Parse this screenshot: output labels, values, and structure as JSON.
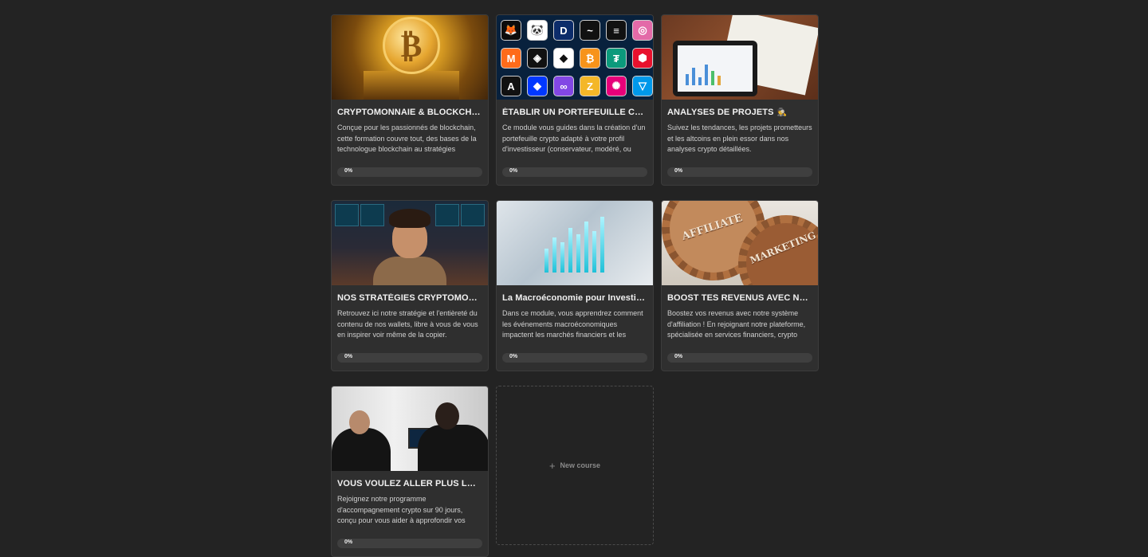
{
  "courses": [
    {
      "title": "CRYPTOMONNAIE & BLOCKCHAIN",
      "description": "Conçue pour les passionnés de blockchain, cette formation couvre tout, des bases de la technologue blockchain au stratégies",
      "progress": "0%",
      "progress_value": 0,
      "thumbnail": "bitcoin-gold-coin-image"
    },
    {
      "title": "ÉTABLIR UN PORTEFEUILLE CRY...",
      "description": "Ce module vous guides dans la création d'un portefeuille crypto adapté à votre profil d'investisseur (conservateur, modéré, ou",
      "progress": "0%",
      "progress_value": 0,
      "thumbnail": "crypto-logos-grid-image"
    },
    {
      "title": "ANALYSES DE PROJETS",
      "title_emoji": "🕵️",
      "description": "Suivez les tendances, les projets prometteurs et les altcoins en plein essor dans nos analyses crypto détaillées.",
      "progress": "0%",
      "progress_value": 0,
      "thumbnail": "tablet-analytics-image"
    },
    {
      "title": "NOS STRATÉGIES CRYPTOMONN...",
      "description": "Retrouvez ici notre stratégie et l'entièreté du contenu de nos wallets, libre à vous de vous en inspirer voir même de la copier.",
      "progress": "0%",
      "progress_value": 0,
      "thumbnail": "trader-desk-image"
    },
    {
      "title": "La Macroéconomie pour Investir I...",
      "description": "Dans ce module, vous apprendrez comment les événements macroéconomiques impactent les marchés financiers et les",
      "progress": "0%",
      "progress_value": 0,
      "thumbnail": "macro-chart-hologram-image"
    },
    {
      "title": "BOOST TES REVENUS AVEC NOT...",
      "description": "Boostez vos revenus avec notre système d'affiliation ! En rejoignant notre plateforme, spécialisée en services financiers, crypto",
      "progress": "0%",
      "progress_value": 0,
      "thumbnail": "affiliate-marketing-gears-image",
      "thumb_text": [
        "AFFILIATE",
        "MARKETING"
      ]
    },
    {
      "title": "VOUS VOULEZ ALLER PLUS LOIN ?",
      "description": "Rejoignez notre programme d'accompagnement crypto sur 90 jours, conçu pour vous aider à approfondir vos",
      "progress": "0%",
      "progress_value": 0,
      "thumbnail": "coaching-meeting-image"
    }
  ],
  "new_course": {
    "icon": "plus-icon",
    "label": "New course"
  },
  "crypto_icons": [
    "🦊",
    "🐼",
    "D",
    "~",
    "≡",
    "◎",
    "M",
    "◈",
    "◆",
    "₿",
    "₮",
    "⬢",
    "A",
    "◆",
    "∞",
    "Z",
    "✺",
    "▽"
  ],
  "crypto_icon_colors": [
    "#0b0b0b",
    "#ffffff",
    "#0c2c6a",
    "#111111",
    "#111111",
    "#e36aa8",
    "#ff6b1a",
    "#111111",
    "#ffffff",
    "#f7931a",
    "#0b9a7c",
    "#e8112d",
    "#111111",
    "#0038ff",
    "#8247e5",
    "#f4b728",
    "#e6007a",
    "#0098ea"
  ],
  "colors": {
    "background": "#232323",
    "card": "#2f2f2f",
    "progress_track": "#3f3f3f"
  }
}
